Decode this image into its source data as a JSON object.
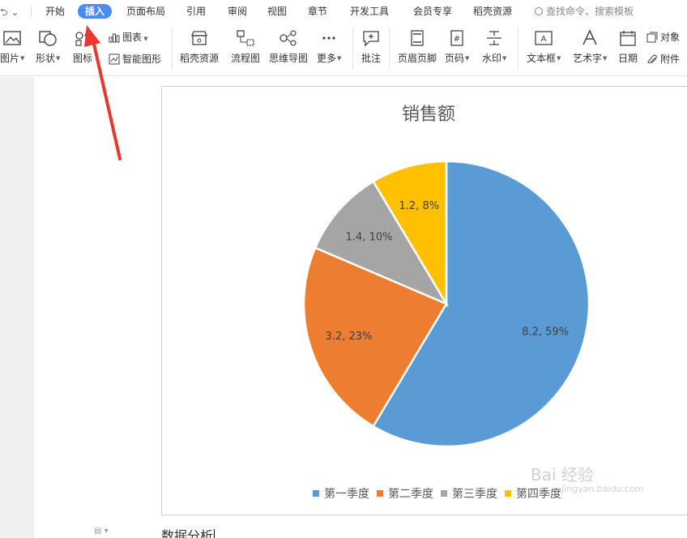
{
  "menu": {
    "items": [
      "开始",
      "插入",
      "页面布局",
      "引用",
      "审阅",
      "视图",
      "章节",
      "开发工具",
      "会员专享",
      "稻壳资源"
    ],
    "active_index": 1,
    "search_placeholder": "查找命令、搜索模板"
  },
  "ribbon": {
    "picture": "图片",
    "shape": "形状",
    "icon": "图标",
    "chart": "图表",
    "smart_shape": "智能图形",
    "docer": "稻壳资源",
    "flowchart": "流程图",
    "mindmap": "思维导图",
    "more": "更多",
    "comment": "批注",
    "header_footer": "页眉页脚",
    "page_number": "页码",
    "watermark": "水印",
    "textbox": "文本框",
    "wordart": "艺术字",
    "date": "日期",
    "object": "对象",
    "attachment": "附件"
  },
  "chart_data": {
    "type": "pie",
    "title": "销售额",
    "categories": [
      "第一季度",
      "第二季度",
      "第三季度",
      "第四季度"
    ],
    "values": [
      8.2,
      3.2,
      1.4,
      1.2
    ],
    "percent_labels": [
      "59%",
      "23%",
      "10%",
      "8%"
    ],
    "data_labels": [
      "8.2, 59%",
      "3.2, 23%",
      "1.4, 10%",
      "1.2, 8%"
    ],
    "colors": [
      "#5b9bd5",
      "#ed7d31",
      "#a5a5a5",
      "#ffc000"
    ],
    "legend_position": "bottom",
    "start_angle": "12 o'clock, clockwise"
  },
  "document": {
    "text": "数据分析"
  },
  "watermark": {
    "brand": "Bai 经验",
    "url": "jingyan.baidu.com"
  },
  "annotation": {
    "arrow_color": "#e8372c"
  }
}
